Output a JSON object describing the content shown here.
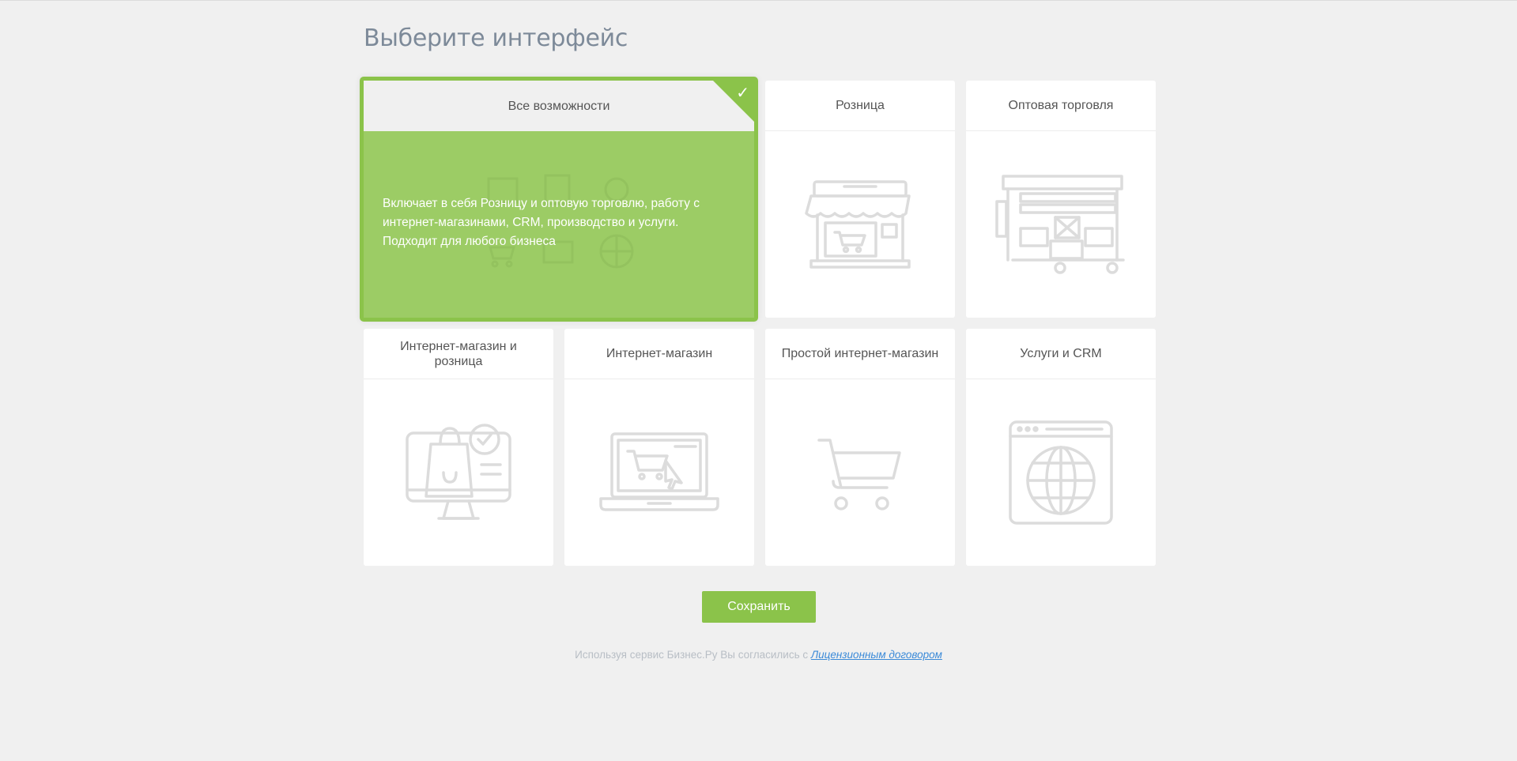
{
  "page": {
    "title": "Выберите интерфейс"
  },
  "cards": [
    {
      "title": "Все возможности",
      "selected": true,
      "description": "Включает в себя Розницу и оптовую торговлю, работу с интернет-магазинами, CRM, производство и услуги. Подходит для любого бизнеса",
      "icon": "all-features-icon"
    },
    {
      "title": "Розница",
      "selected": false,
      "icon": "storefront-icon"
    },
    {
      "title": "Оптовая торговля",
      "selected": false,
      "icon": "warehouse-icon"
    },
    {
      "title": "Интернет-магазин и розница",
      "selected": false,
      "icon": "monitor-shopping-bag-icon"
    },
    {
      "title": "Интернет-магазин",
      "selected": false,
      "icon": "laptop-cart-icon"
    },
    {
      "title": "Простой интернет-магазин",
      "selected": false,
      "icon": "cart-icon"
    },
    {
      "title": "Услуги и CRM",
      "selected": false,
      "icon": "globe-window-icon"
    }
  ],
  "save_button": {
    "label": "Сохранить"
  },
  "footer": {
    "text": "Используя сервис Бизнес.Ру Вы согласились с ",
    "link_text": "Лицензионным договором"
  },
  "colors": {
    "accent": "#8bc34a",
    "selected_fill": "#9ccc65",
    "background": "#f0f0f0",
    "title": "#7d8a99",
    "link": "#3b8ad8"
  }
}
